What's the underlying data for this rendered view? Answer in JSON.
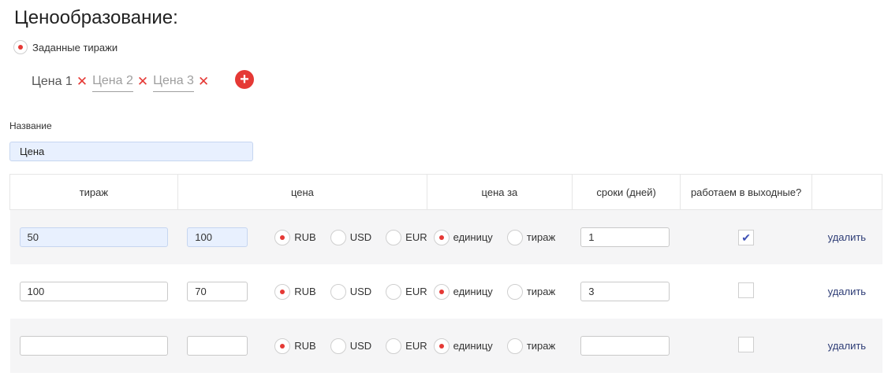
{
  "page": {
    "title": "Ценообразование:"
  },
  "pricing_mode": {
    "label": "Заданные тиражи",
    "selected": true
  },
  "price_tabs": [
    {
      "label": "Цена 1",
      "active": true
    },
    {
      "label": "Цена 2",
      "active": false
    },
    {
      "label": "Цена 3",
      "active": false
    }
  ],
  "add_tab_symbol": "+",
  "name_field": {
    "label": "Название",
    "value": "Цена"
  },
  "table": {
    "headers": [
      "тираж",
      "цена",
      "цена за",
      "сроки (днeй)",
      "работаем в выходные?"
    ],
    "currency_options": [
      "RUB",
      "USD",
      "EUR"
    ],
    "per_options": [
      "единицу",
      "тираж"
    ],
    "delete_label": "удалить",
    "checkmark": "✔",
    "rows": [
      {
        "qty": "50",
        "price": "100",
        "currency": "RUB",
        "per": "единицу",
        "days": "1",
        "weekends": true
      },
      {
        "qty": "100",
        "price": "70",
        "currency": "RUB",
        "per": "единицу",
        "days": "3",
        "weekends": false
      },
      {
        "qty": "",
        "price": "",
        "currency": "RUB",
        "per": "единицу",
        "days": "",
        "weekends": false
      }
    ]
  },
  "colors": {
    "accent": "#e53935",
    "link": "#2f3e77",
    "row_shade": "#f5f5f6",
    "autofill": "#e8f0fe"
  }
}
